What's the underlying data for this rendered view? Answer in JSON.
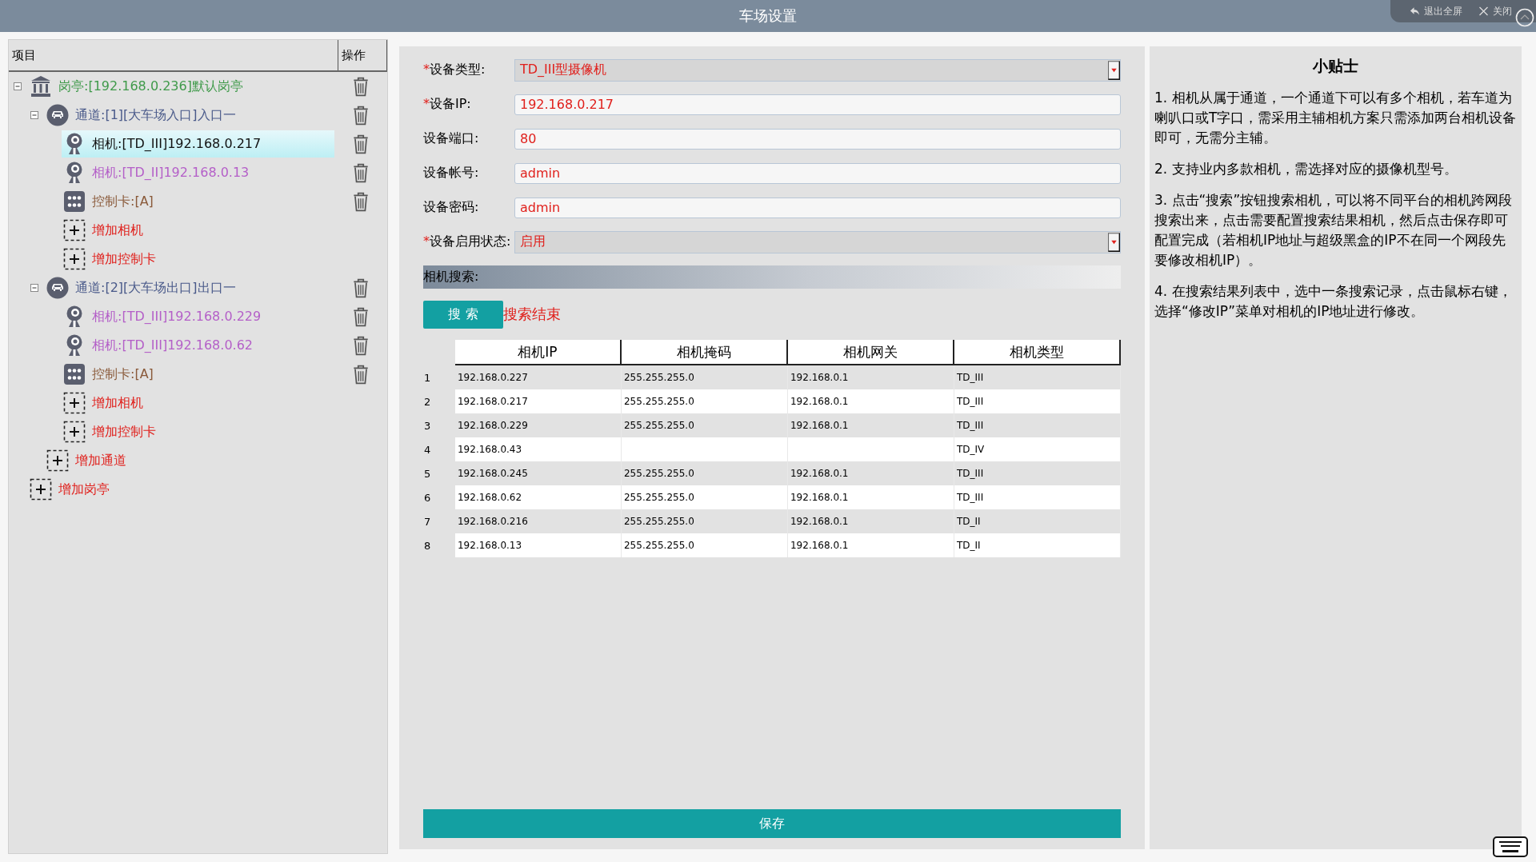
{
  "window": {
    "title": "车场设置"
  },
  "overlay": {
    "buttons": [
      {
        "kind": "exit-fullscreen",
        "label": "退出全屏"
      },
      {
        "kind": "close",
        "label": "关闭"
      }
    ]
  },
  "tree": {
    "columns": [
      "项目",
      "操作"
    ],
    "items": [
      {
        "kind": "booth",
        "label": "岗亭:[192.168.0.236]默认岗亭",
        "color": "#3f9a4a",
        "selected": false,
        "expanded": true,
        "children": [
          {
            "kind": "lane",
            "label": "通道:[1][大车场入口]入口一",
            "color": "#4a5a8a",
            "selected": false,
            "expanded": true,
            "children": [
              {
                "kind": "camera",
                "label": "相机:[TD_III]192.168.0.217",
                "color": "#111111",
                "selected": true
              },
              {
                "kind": "camera",
                "label": "相机:[TD_II]192.168.0.13",
                "color": "#b45fc8",
                "selected": false
              },
              {
                "kind": "card",
                "label": "控制卡:[A]",
                "color": "#8a5a3a",
                "selected": false
              },
              {
                "kind": "add",
                "label": "增加相机",
                "color": "#e0201c",
                "selected": false
              },
              {
                "kind": "add",
                "label": "增加控制卡",
                "color": "#e0201c",
                "selected": false
              }
            ]
          },
          {
            "kind": "lane",
            "label": "通道:[2][大车场出口]出口一",
            "color": "#4a5a8a",
            "selected": false,
            "expanded": true,
            "children": [
              {
                "kind": "camera",
                "label": "相机:[TD_III]192.168.0.229",
                "color": "#b45fc8",
                "selected": false
              },
              {
                "kind": "camera",
                "label": "相机:[TD_III]192.168.0.62",
                "color": "#b45fc8",
                "selected": false
              },
              {
                "kind": "card",
                "label": "控制卡:[A]",
                "color": "#8a5a3a",
                "selected": false
              },
              {
                "kind": "add",
                "label": "增加相机",
                "color": "#e0201c",
                "selected": false
              },
              {
                "kind": "add",
                "label": "增加控制卡",
                "color": "#e0201c",
                "selected": false
              }
            ]
          },
          {
            "kind": "add",
            "label": "增加通道",
            "color": "#e0201c",
            "selected": false
          }
        ]
      },
      {
        "kind": "add",
        "label": "增加岗亭",
        "color": "#e0201c",
        "selected": false
      }
    ]
  },
  "form": {
    "fields": [
      {
        "kind": "select",
        "mark": "*",
        "label": "设备类型:",
        "value": "TD_III型摄像机"
      },
      {
        "kind": "text",
        "mark": "*",
        "label": "设备IP:",
        "value": "192.168.0.217"
      },
      {
        "kind": "text",
        "label": "设备端口:",
        "value": "80"
      },
      {
        "kind": "text",
        "label": "设备帐号:",
        "value": "admin"
      },
      {
        "kind": "text",
        "label": "设备密码:",
        "value": "admin"
      },
      {
        "kind": "select",
        "mark": "*",
        "label": "设备启用状态:",
        "value": "启用"
      }
    ]
  },
  "search": {
    "section_title": "相机搜索:",
    "button": "搜 索",
    "status": "搜索结束"
  },
  "results": {
    "columns": [
      "相机IP",
      "相机掩码",
      "相机网关",
      "相机类型"
    ],
    "rows": [
      {
        "index": "1",
        "cells": [
          "192.168.0.227",
          "255.255.255.0",
          "192.168.0.1",
          "TD_III"
        ]
      },
      {
        "index": "2",
        "cells": [
          "192.168.0.217",
          "255.255.255.0",
          "192.168.0.1",
          "TD_III"
        ]
      },
      {
        "index": "3",
        "cells": [
          "192.168.0.229",
          "255.255.255.0",
          "192.168.0.1",
          "TD_III"
        ]
      },
      {
        "index": "4",
        "cells": [
          "192.168.0.43",
          null,
          null,
          "TD_IV"
        ]
      },
      {
        "index": "5",
        "cells": [
          "192.168.0.245",
          "255.255.255.0",
          "192.168.0.1",
          "TD_III"
        ]
      },
      {
        "index": "6",
        "cells": [
          "192.168.0.62",
          "255.255.255.0",
          "192.168.0.1",
          "TD_III"
        ]
      },
      {
        "index": "7",
        "cells": [
          "192.168.0.216",
          "255.255.255.0",
          "192.168.0.1",
          "TD_II"
        ]
      },
      {
        "index": "8",
        "cells": [
          "192.168.0.13",
          "255.255.255.0",
          "192.168.0.1",
          "TD_II"
        ]
      }
    ]
  },
  "save_button": "保存",
  "tips": {
    "title": "小贴士",
    "paragraphs": [
      "1. 相机从属于通道，一个通道下可以有多个相机，若车道为喇叭口或T字口，需采用主辅相机方案只需添加两台相机设备即可，无需分主辅。",
      "2. 支持业内多款相机，需选择对应的摄像机型号。",
      "3. 点击“搜索”按钮搜索相机，可以将不同平台的相机跨网段搜索出来，点击需要配置搜索结果相机，然后点击保存即可配置完成（若相机IP地址与超级黑盒的IP不在同一个网段先要修改相机IP）。",
      "4. 在搜索结果列表中，选中一条搜索记录，点击鼠标右键，选择“修改IP”菜单对相机的IP地址进行修改。"
    ]
  }
}
